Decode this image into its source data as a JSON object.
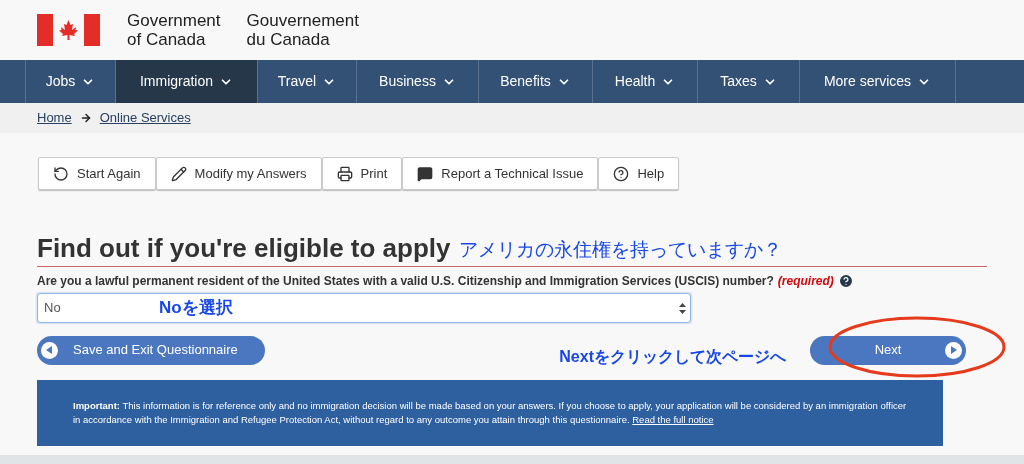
{
  "header": {
    "name_en": [
      "Government",
      "of Canada"
    ],
    "name_fr": [
      "Gouvernement",
      "du Canada"
    ]
  },
  "nav": [
    {
      "label": "Jobs",
      "selected": false
    },
    {
      "label": "Immigration",
      "selected": true
    },
    {
      "label": "Travel",
      "selected": false
    },
    {
      "label": "Business",
      "selected": false
    },
    {
      "label": "Benefits",
      "selected": false
    },
    {
      "label": "Health",
      "selected": false
    },
    {
      "label": "Taxes",
      "selected": false
    },
    {
      "label": "More services",
      "selected": false
    }
  ],
  "breadcrumb": [
    "Home",
    "Online Services"
  ],
  "toolbar": [
    {
      "kind": "restart",
      "label": "Start Again"
    },
    {
      "kind": "edit",
      "label": "Modify my Answers"
    },
    {
      "kind": "print",
      "label": "Print"
    },
    {
      "kind": "comment",
      "label": "Report a Technical Issue"
    },
    {
      "kind": "help",
      "label": "Help"
    }
  ],
  "heading": "Find out if you're eligible to apply",
  "question": {
    "label": "Are you a lawful permanent resident of the United States with a valid U.S. Citizenship and Immigration Services (USCIS) number?",
    "required": "(required)",
    "value": "No"
  },
  "buttons": {
    "save": "Save and Exit Questionnaire",
    "next": "Next"
  },
  "notice": {
    "text": "**Important:** This information is for reference only and no immigration decision will be made based on your answers. If you choose to apply, your application will be considered by an immigration officer in accordance with the Immigration and Refugee Protection Act, without regard to any outcome you attain through this questionnaire.",
    "link": "Read the full notice"
  },
  "annotations": {
    "heading_note": "アメリカの永住権を持っていますか？",
    "select_note": "Noを選択",
    "next_note": "Nextをクリックして次ページへ"
  }
}
